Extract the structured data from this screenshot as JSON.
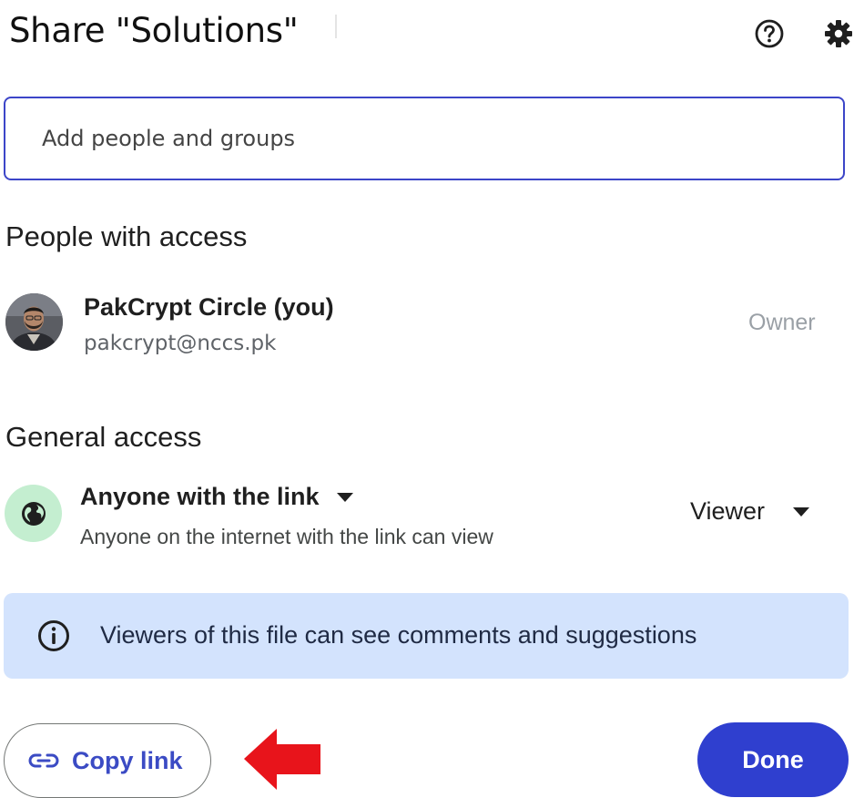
{
  "dialog": {
    "title": "Share \"Solutions\""
  },
  "search": {
    "placeholder": "Add people and groups"
  },
  "people_section": {
    "heading": "People with access",
    "people": [
      {
        "name": "PakCrypt Circle (you)",
        "email": "pakcrypt@nccs.pk",
        "role": "Owner"
      }
    ]
  },
  "general_access": {
    "heading": "General access",
    "link_setting": "Anyone with the link",
    "description": "Anyone on the internet with the link can view",
    "role": "Viewer"
  },
  "info_banner": {
    "text": "Viewers of this file can see comments and suggestions"
  },
  "footer": {
    "copy_link_label": "Copy link",
    "done_label": "Done"
  },
  "colors": {
    "accent": "#3c45c8",
    "done_button": "#2f3fcf",
    "banner_bg": "#d3e3fd",
    "globe_bg": "#c4eed0",
    "annotation_arrow": "#e8141b"
  },
  "icons": {
    "help": "help-circle-icon",
    "settings": "gear-icon",
    "globe": "globe-icon",
    "dropdown": "caret-down-icon",
    "info": "info-icon",
    "link": "link-icon"
  }
}
